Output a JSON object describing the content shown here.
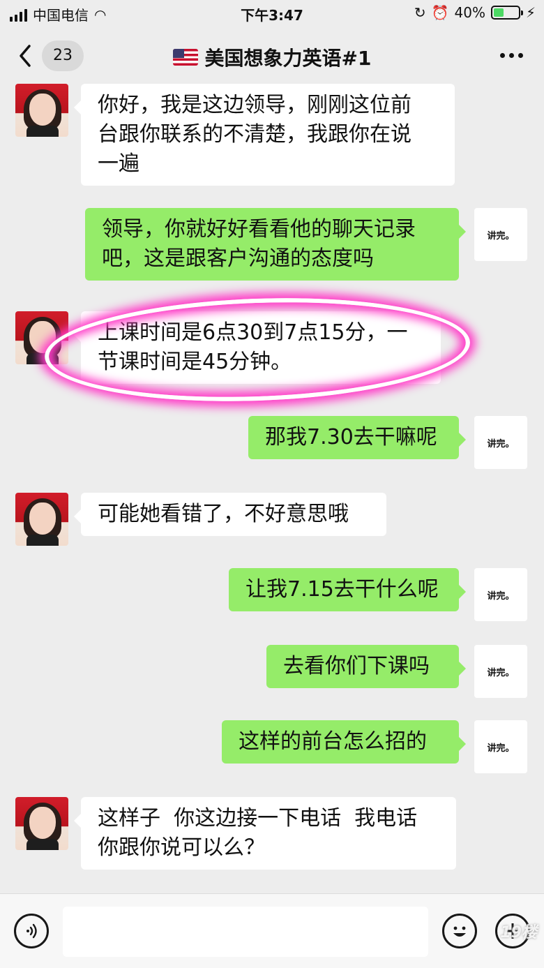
{
  "status_bar": {
    "carrier": "中国电信",
    "time": "下午3:47",
    "battery_percent": "40%",
    "battery_level": 0.4
  },
  "nav": {
    "unread_count": "23",
    "title": "美国想象力英语#1"
  },
  "me_avatar_text": "讲完。",
  "messages": [
    {
      "side": "in",
      "text": "你好，我是这边领导，刚刚这位前\n台跟你联系的不清楚，我跟你在说\n一遍"
    },
    {
      "side": "out",
      "text": "领导，你就好好看看他的聊天记录\n吧，这是跟客户沟通的态度吗"
    },
    {
      "side": "in",
      "text": "上课时间是6点30到7点15分，一\n节课时间是45分钟。",
      "highlighted": true
    },
    {
      "side": "out",
      "text": "那我7.30去干嘛呢"
    },
    {
      "side": "in",
      "text": "可能她看错了，不好意思哦"
    },
    {
      "side": "out",
      "text": "让我7.15去干什么呢"
    },
    {
      "side": "out",
      "text": "去看你们下课吗"
    },
    {
      "side": "out",
      "text": "这样的前台怎么招的"
    },
    {
      "side": "in",
      "text": "这样子  你这边接一下电话  我电话\n你跟你说可以么？"
    }
  ],
  "input": {
    "placeholder": ""
  },
  "watermark": "19楼",
  "colors": {
    "outgoing_bubble": "#95ec69",
    "incoming_bubble": "#ffffff",
    "highlight": "#ff3cc8"
  }
}
